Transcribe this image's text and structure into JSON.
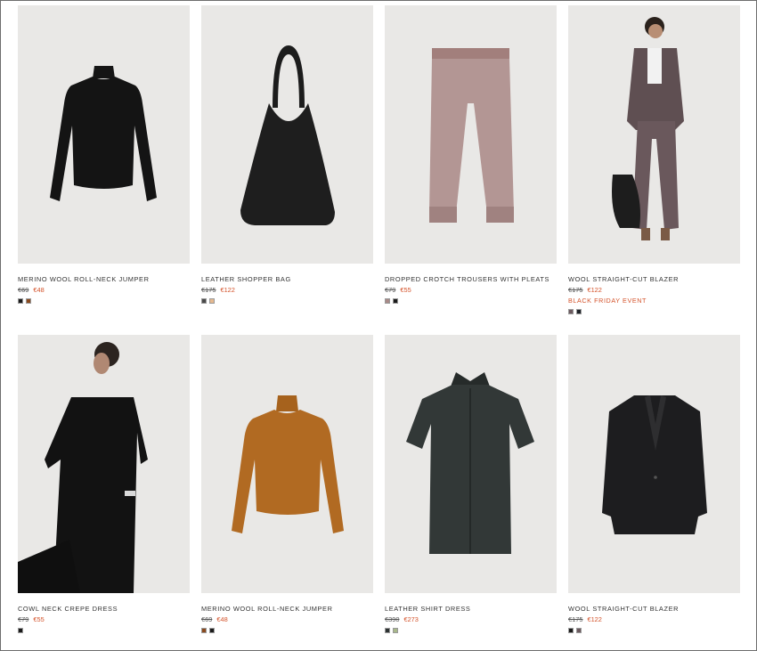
{
  "products": [
    {
      "name": "MERINO WOOL ROLL-NECK JUMPER",
      "old_price": "€69",
      "new_price": "€48",
      "event": "",
      "swatches": [
        "#1b1b1b",
        "#8b4a1e"
      ],
      "image": "black roll-neck jumper"
    },
    {
      "name": "LEATHER SHOPPER BAG",
      "old_price": "€175",
      "new_price": "€122",
      "event": "",
      "swatches": [
        "#4a4a4a",
        "#e6b98f"
      ],
      "image": "black leather shopper bag"
    },
    {
      "name": "DROPPED CROTCH TROUSERS WITH PLEATS",
      "old_price": "€79",
      "new_price": "€55",
      "event": "",
      "swatches": [
        "#a98a88",
        "#1b1b1b"
      ],
      "image": "dusty pink pleated trousers"
    },
    {
      "name": "WOOL STRAIGHT-CUT BLAZER",
      "old_price": "€175",
      "new_price": "€122",
      "event": "BLACK FRIDAY EVENT",
      "swatches": [
        "#6c5a5f",
        "#1e2228"
      ],
      "image": "model in mauve suit"
    },
    {
      "name": "COWL NECK CREPE DRESS",
      "old_price": "€79",
      "new_price": "€55",
      "event": "",
      "swatches": [
        "#1b1b1b"
      ],
      "image": "model in black crepe dress"
    },
    {
      "name": "MERINO WOOL ROLL-NECK JUMPER",
      "old_price": "€69",
      "new_price": "€48",
      "event": "",
      "swatches": [
        "#8b4a1e",
        "#1b1b1b"
      ],
      "image": "ochre roll-neck jumper"
    },
    {
      "name": "LEATHER SHIRT DRESS",
      "old_price": "€390",
      "new_price": "€273",
      "event": "",
      "swatches": [
        "#2d3232",
        "#a8b88a"
      ],
      "image": "dark green leather shirt dress"
    },
    {
      "name": "WOOL STRAIGHT-CUT BLAZER",
      "old_price": "€175",
      "new_price": "€122",
      "event": "",
      "swatches": [
        "#1b1b1b",
        "#6c5a5f"
      ],
      "image": "black straight-cut blazer"
    }
  ],
  "colors": {
    "sale": "#d4532b",
    "image_bg": "#e9e8e6"
  }
}
